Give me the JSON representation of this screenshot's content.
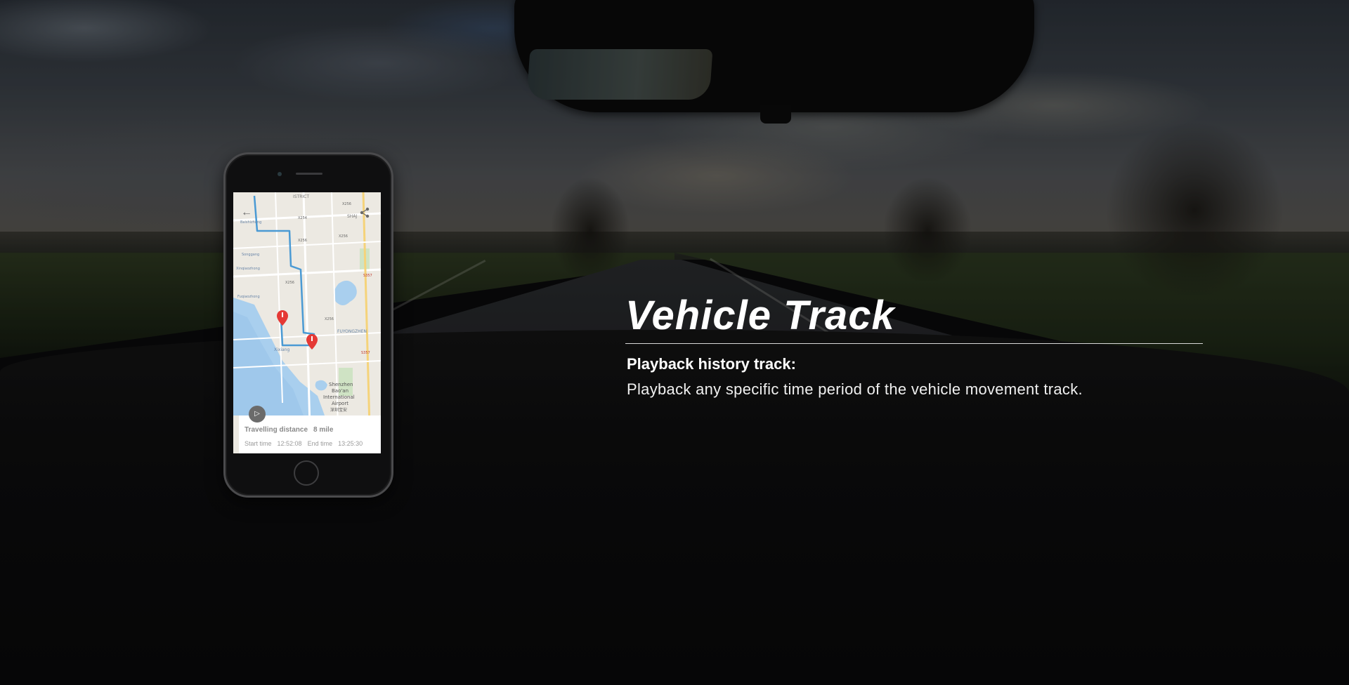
{
  "hero": {
    "title": "Vehicle Track",
    "subtitle": "Playback history track:",
    "description": "Playback any specific time period of the vehicle movement track."
  },
  "phone_app": {
    "back_icon": "arrow-left-icon",
    "share_icon": "share-icon",
    "play_icon": "play-icon",
    "marker_icon": "map-pin-icon",
    "route_color": "#4a9ad4",
    "marker_color": "#e53935",
    "map_labels": [
      "ISTRICT",
      "X256",
      "Baishizhong",
      "SHAJ",
      "X254",
      "X256",
      "Songgang",
      "X256",
      "Xinqiaozhong",
      "X256",
      "S357",
      "Fuqiaozhong",
      "X256",
      "FUYONGZHEN",
      "Xixiang",
      "S357",
      "Shenzhen",
      "Bao'an",
      "International",
      "Airport",
      "深圳宝安"
    ],
    "trip": {
      "distance_label": "Travelling distance",
      "distance_value": "8 mile",
      "start_label": "Start time",
      "start_value": "12:52:08",
      "end_label": "End time",
      "end_value": "13:25:30"
    }
  }
}
